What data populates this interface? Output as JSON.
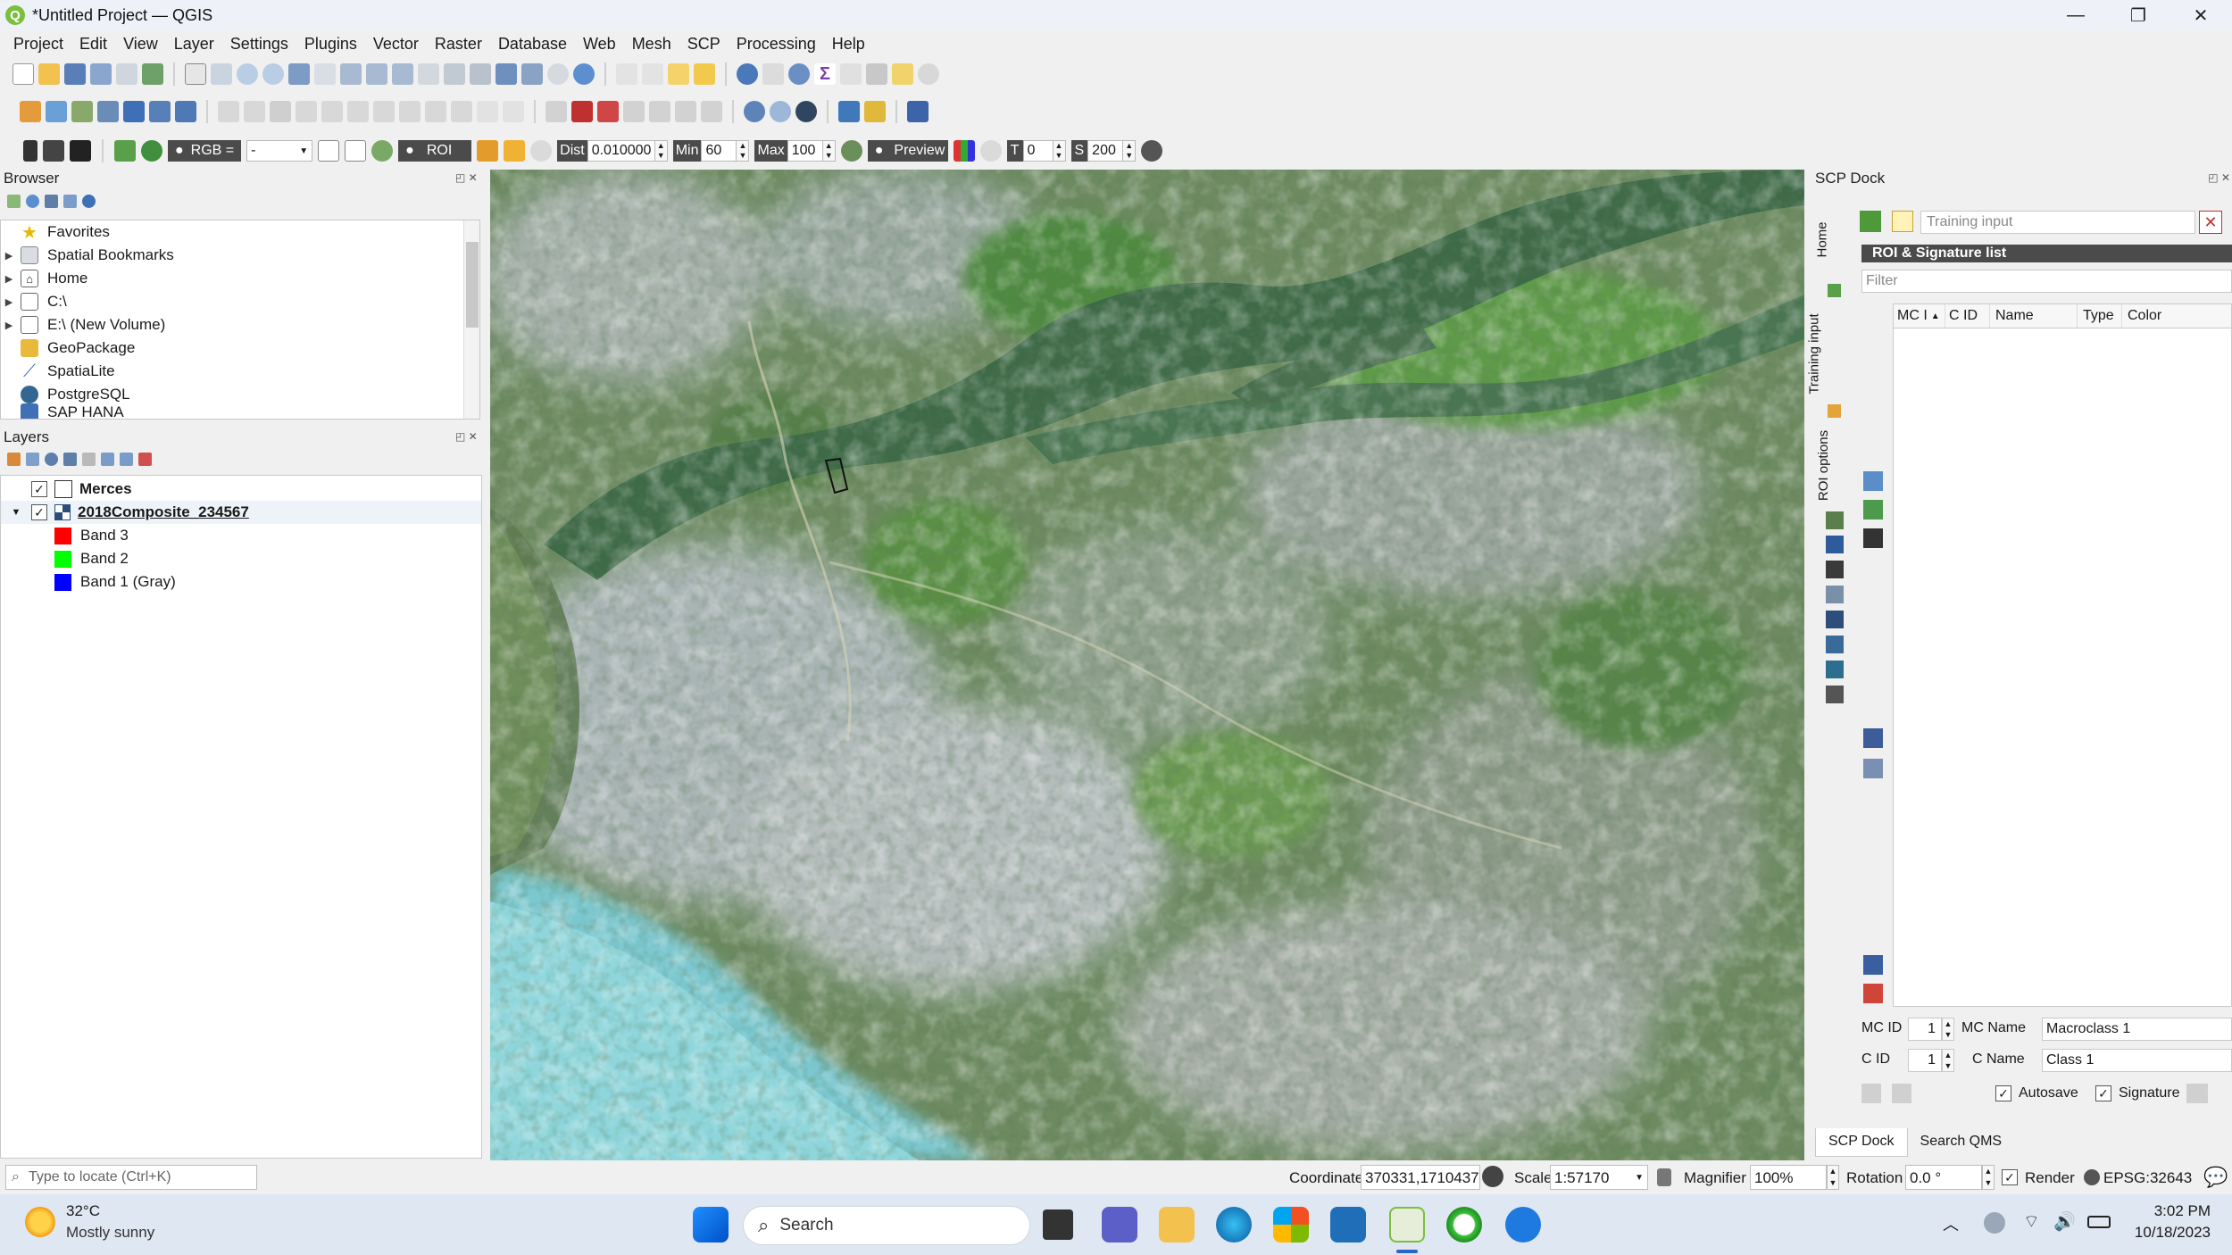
{
  "window": {
    "title": "*Untitled Project — QGIS",
    "logo_letter": "Q",
    "minimize": "—",
    "maximize": "❐",
    "close": "✕"
  },
  "menu": [
    "Project",
    "Edit",
    "View",
    "Layer",
    "Settings",
    "Plugins",
    "Vector",
    "Raster",
    "Database",
    "Web",
    "Mesh",
    "SCP",
    "Processing",
    "Help"
  ],
  "scp_toolbar": {
    "rgb_label": "RGB =",
    "rgb_value": "-",
    "roi_label": "ROI",
    "dist_label": "Dist",
    "dist_value": "0.010000",
    "min_label": "Min",
    "min_value": "60",
    "max_label": "Max",
    "max_value": "100",
    "preview_label": "Preview",
    "t_label": "T",
    "t_value": "0",
    "s_label": "S",
    "s_value": "200"
  },
  "browser": {
    "title": "Browser",
    "items": [
      {
        "label": "Favorites",
        "icon": "star-icon",
        "arrow": ""
      },
      {
        "label": "Spatial Bookmarks",
        "icon": "bookmark-icon",
        "arrow": "▶"
      },
      {
        "label": "Home",
        "icon": "home-folder-icon",
        "arrow": "▶"
      },
      {
        "label": "C:\\",
        "icon": "folder-icon",
        "arrow": "▶"
      },
      {
        "label": "E:\\ (New Volume)",
        "icon": "folder-icon",
        "arrow": "▶"
      },
      {
        "label": "GeoPackage",
        "icon": "geopackage-icon",
        "arrow": ""
      },
      {
        "label": "SpatiaLite",
        "icon": "spatialite-icon",
        "arrow": ""
      },
      {
        "label": "PostgreSQL",
        "icon": "postgresql-icon",
        "arrow": ""
      },
      {
        "label": "SAP HANA",
        "icon": "saphana-icon",
        "arrow": ""
      }
    ]
  },
  "layers": {
    "title": "Layers",
    "items": [
      {
        "label": "Merces",
        "checked": true,
        "bold": true
      },
      {
        "label": "2018Composite_234567",
        "checked": true,
        "bold": true
      },
      {
        "label": "Band 3",
        "swatch": "#ff0000"
      },
      {
        "label": "Band 2",
        "swatch": "#00ff00"
      },
      {
        "label": "Band 1 (Gray)",
        "swatch": "#0000ff"
      }
    ]
  },
  "scp_dock": {
    "title": "SCP Dock",
    "vertical_tabs": [
      "Home",
      "Training input",
      "ROI options"
    ],
    "training_input_placeholder": "Training input",
    "roi_sig_header": "ROI & Signature list",
    "filter_placeholder": "Filter",
    "columns": [
      "MC I",
      "C ID",
      "Name",
      "Type",
      "Color"
    ],
    "mc_id_label": "MC ID",
    "mc_id_value": "1",
    "mc_name_label": "MC Name",
    "mc_name_value": "Macroclass 1",
    "c_id_label": "C ID",
    "c_id_value": "1",
    "c_name_label": "C Name",
    "c_name_value": "Class 1",
    "autosave_label": "Autosave",
    "signature_label": "Signature",
    "bottom_tabs": [
      "SCP Dock",
      "Search QMS"
    ]
  },
  "status": {
    "locate_placeholder": "Type to locate (Ctrl+K)",
    "coordinate_label": "Coordinate",
    "coordinate_value": "370331,1710437",
    "scale_label": "Scale",
    "scale_value": "1:57170",
    "magnifier_label": "Magnifier",
    "magnifier_value": "100%",
    "rotation_label": "Rotation",
    "rotation_value": "0.0 °",
    "render_label": "Render",
    "crs": "EPSG:32643"
  },
  "taskbar": {
    "temperature": "32°C",
    "weather": "Mostly sunny",
    "search_label": "Search",
    "time": "3:02 PM",
    "date": "10/18/2023"
  }
}
